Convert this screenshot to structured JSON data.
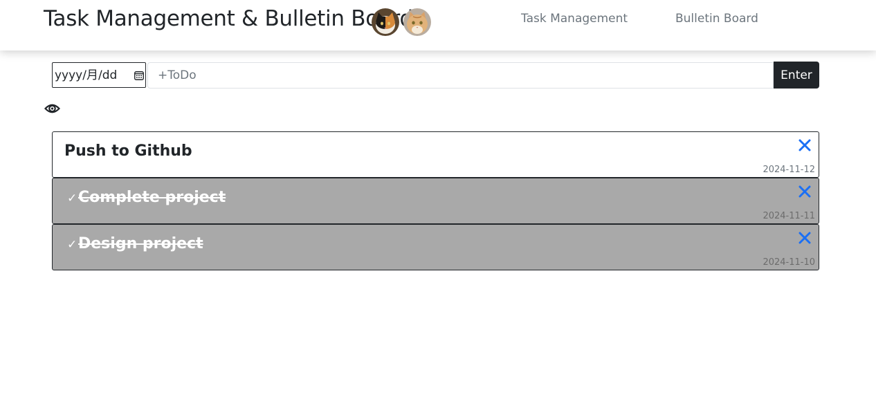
{
  "header": {
    "title": "Task Management & Bulletin Board",
    "avatars": [
      "calico-cat-avatar",
      "orange-cat-avatar"
    ],
    "nav": {
      "task_management": "Task Management",
      "bulletin_board": "Bulletin Board"
    }
  },
  "form": {
    "date_placeholder": "yyyy/月/dd",
    "todo_placeholder": "+ToDo",
    "enter_label": "Enter"
  },
  "icons": {
    "visibility": "eye-icon",
    "calendar": "calendar-icon",
    "delete": "close-icon",
    "done": "checkmark"
  },
  "tasks": [
    {
      "title": "Push to Github",
      "date": "2024-11-12",
      "done": false
    },
    {
      "title": "Complete project",
      "date": "2024-11-11",
      "done": true
    },
    {
      "title": "Design project",
      "date": "2024-11-10",
      "done": true
    }
  ],
  "colors": {
    "accent": "#1a6ff5",
    "done_bg": "#a9a9a9",
    "button_bg": "#212529"
  }
}
